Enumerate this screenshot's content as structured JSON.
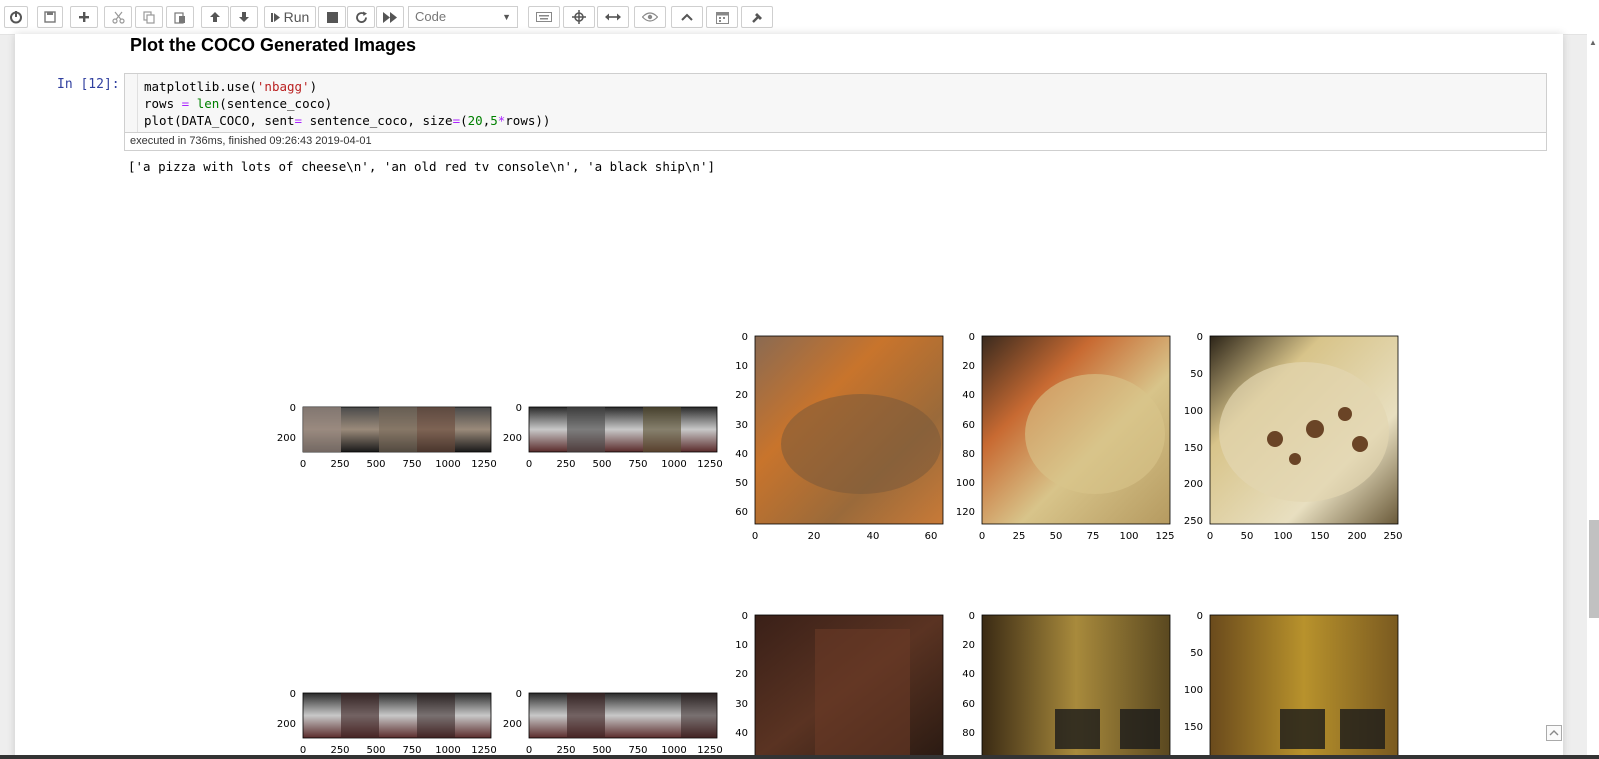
{
  "toolbar": {
    "run_label": "Run",
    "cell_type": "Code",
    "icons": [
      "power-icon",
      "save-icon",
      "plus-icon",
      "cut-icon",
      "copy-icon",
      "paste-icon",
      "arrow-up-icon",
      "arrow-down-icon",
      "run-icon",
      "stop-icon",
      "restart-icon",
      "fast-forward-icon",
      "keyboard-icon",
      "crosshair-icon",
      "arrows-horizontal-icon",
      "eye-icon",
      "chevron-up-icon",
      "calendar-icon",
      "wrench-icon"
    ]
  },
  "cell": {
    "heading": "Plot the COCO Generated Images",
    "prompt": "In [12]:",
    "code": {
      "line1_a": "matplotlib.use(",
      "line1_str": "'nbagg'",
      "line1_b": ")",
      "line2_a": "rows ",
      "line2_eq": "=",
      "line2_fn": " len",
      "line2_b": "(sentence_coco)",
      "line3_a": "plot(DATA_COCO, sent",
      "line3_eq": "=",
      "line3_b": " sentence_coco, size",
      "line3_eq2": "=",
      "line3_c": "(",
      "line3_n1": "20",
      "line3_d": ",",
      "line3_n2": "5",
      "line3_op": "*",
      "line3_e": "rows))"
    },
    "exec_status": "executed in 736ms, finished 09:26:43 2019-04-01",
    "output": "['a pizza with lots of cheese\\n', 'an old red tv console\\n', 'a black ship\\n']"
  },
  "figure": {
    "row1": {
      "strip_yticks": [
        "0",
        "200"
      ],
      "strip_xticks": [
        "0",
        "250",
        "500",
        "750",
        "1000",
        "1250"
      ],
      "img64_yticks": [
        "0",
        "10",
        "20",
        "30",
        "40",
        "50",
        "60"
      ],
      "img64_xticks": [
        "0",
        "20",
        "40",
        "60"
      ],
      "img128_yticks": [
        "0",
        "20",
        "40",
        "60",
        "80",
        "100",
        "120"
      ],
      "img128_xticks": [
        "0",
        "25",
        "50",
        "75",
        "100",
        "125"
      ],
      "img256_yticks": [
        "0",
        "50",
        "100",
        "150",
        "200",
        "250"
      ],
      "img256_xticks": [
        "0",
        "50",
        "100",
        "150",
        "200",
        "250"
      ]
    },
    "row2": {
      "strip_yticks": [
        "0",
        "200"
      ],
      "strip_xticks": [
        "0",
        "250",
        "500",
        "750",
        "1000",
        "1250"
      ],
      "img64_yticks": [
        "0",
        "10",
        "20",
        "30",
        "40"
      ],
      "img128_yticks": [
        "0",
        "20",
        "40",
        "60",
        "80"
      ],
      "img256_yticks": [
        "0",
        "50",
        "100",
        "150"
      ]
    },
    "colors": {
      "pizza_crust": "#c8742c",
      "pizza_cheese": "#d8c48a",
      "room_brown": "#5a3322",
      "room_yellow": "#a88a3c"
    }
  }
}
